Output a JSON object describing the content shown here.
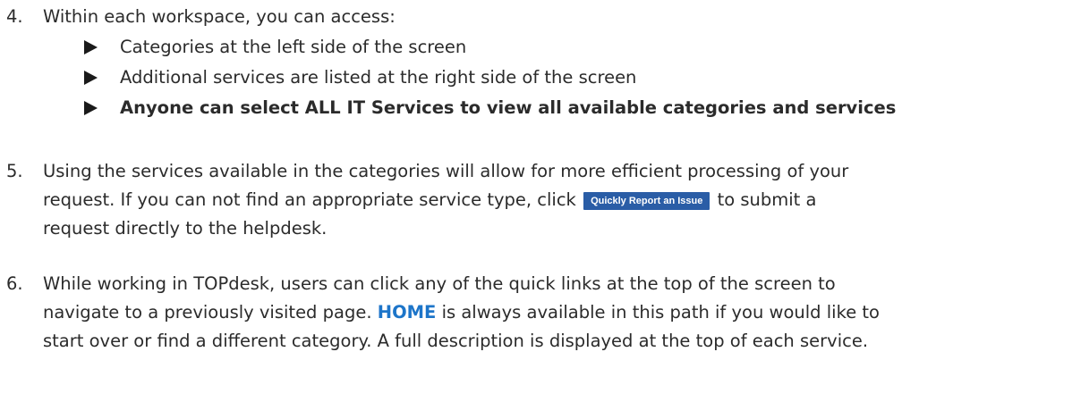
{
  "steps": {
    "step4": {
      "number": "4.",
      "text": "Within each workspace, you can access:",
      "bullets": [
        "Categories at the left side of the screen",
        "Additional services are listed at the right side of the screen",
        "Anyone can select ALL IT Services to view all available categories and services"
      ]
    },
    "step5": {
      "number": "5.",
      "line1": "Using the services available in the categories will allow for more efficient processing of your",
      "line2_before": "request.  If you can not find an appropriate service type, click",
      "button_label": "Quickly Report an Issue",
      "line2_after": "to submit a",
      "line3": "request directly to the helpdesk."
    },
    "step6": {
      "number": "6.",
      "line1": "While working in TOPdesk, users can click any of the quick links at the top of the screen to",
      "line2_before": "navigate to a previously visited page.",
      "home_label": "HOME",
      "line2_after": "is always available in this path if you would like to",
      "line3": "start over or find a different category. A full description is displayed at the top of each service."
    }
  },
  "colors": {
    "text": "#2b2b2b",
    "link_blue": "#1d75c9",
    "button_bg": "#2a5da6",
    "button_text": "#ffffff"
  }
}
